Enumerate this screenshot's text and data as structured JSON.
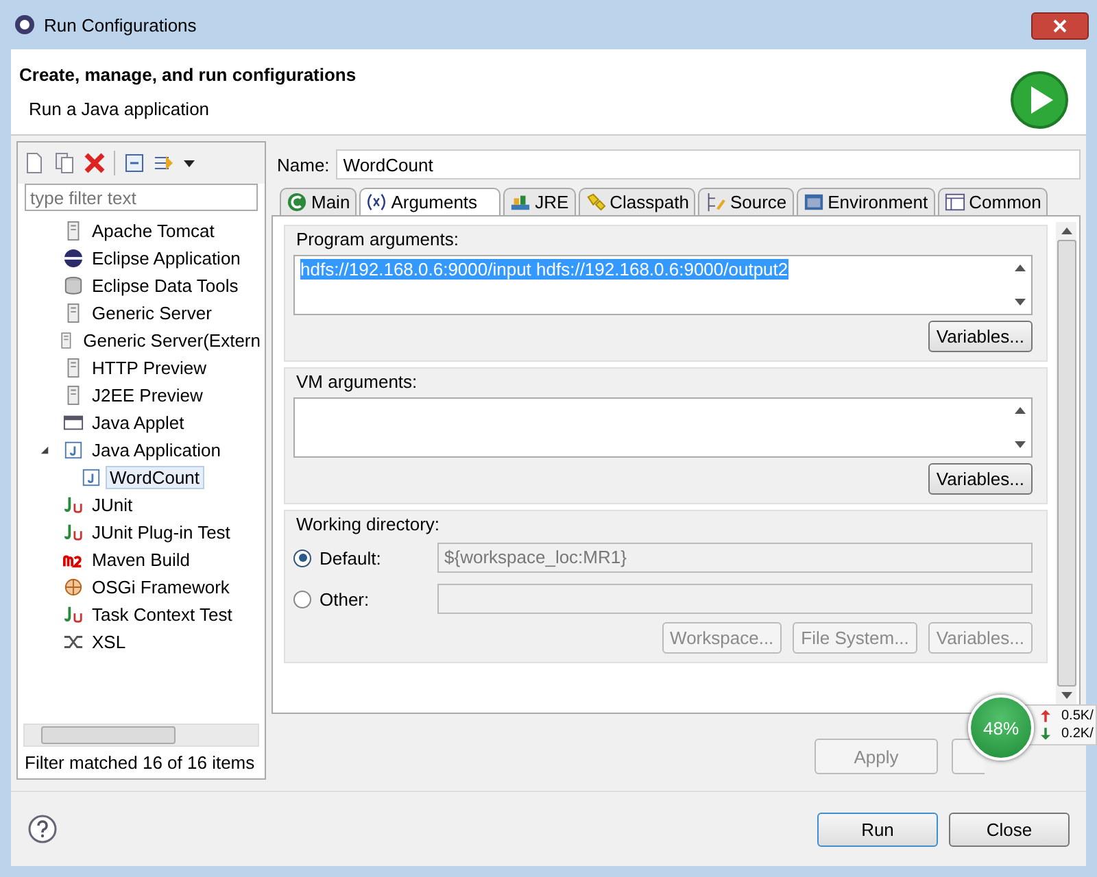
{
  "window": {
    "title": "Run Configurations"
  },
  "header": {
    "title": "Create, manage, and run configurations",
    "subtitle": "Run a Java application"
  },
  "sidebar": {
    "filter_placeholder": "type filter text",
    "items": [
      {
        "label": "Apache Tomcat",
        "selected": false
      },
      {
        "label": "Eclipse Application",
        "selected": false
      },
      {
        "label": "Eclipse Data Tools",
        "selected": false
      },
      {
        "label": "Generic Server",
        "selected": false
      },
      {
        "label": "Generic Server(Extern",
        "selected": false
      },
      {
        "label": "HTTP Preview",
        "selected": false
      },
      {
        "label": "J2EE Preview",
        "selected": false
      },
      {
        "label": "Java Applet",
        "selected": false
      },
      {
        "label": "Java Application",
        "selected": false,
        "expanded": true,
        "children": [
          {
            "label": "WordCount",
            "selected": true
          }
        ]
      },
      {
        "label": "JUnit",
        "selected": false
      },
      {
        "label": "JUnit Plug-in Test",
        "selected": false
      },
      {
        "label": "Maven Build",
        "selected": false
      },
      {
        "label": "OSGi Framework",
        "selected": false
      },
      {
        "label": "Task Context Test",
        "selected": false
      },
      {
        "label": "XSL",
        "selected": false
      }
    ],
    "status": "Filter matched 16 of 16 items"
  },
  "name": {
    "label": "Name:",
    "value": "WordCount"
  },
  "tabs": [
    {
      "label": "Main",
      "selected": false
    },
    {
      "label": "Arguments",
      "selected": true
    },
    {
      "label": "JRE",
      "selected": false
    },
    {
      "label": "Classpath",
      "selected": false
    },
    {
      "label": "Source",
      "selected": false
    },
    {
      "label": "Environment",
      "selected": false
    },
    {
      "label": "Common",
      "selected": false
    }
  ],
  "program_arguments": {
    "label": "Program arguments:",
    "value": "hdfs://192.168.0.6:9000/input hdfs://192.168.0.6:9000/output2",
    "button": "Variables..."
  },
  "vm_arguments": {
    "label": "VM arguments:",
    "button": "Variables..."
  },
  "working_directory": {
    "label": "Working directory:",
    "options": [
      {
        "label": "Default:",
        "selected": true,
        "value": "${workspace_loc:MR1}"
      },
      {
        "label": "Other:",
        "selected": false
      }
    ],
    "buttons": [
      "Workspace...",
      "File System...",
      "Variables..."
    ]
  },
  "footer": {
    "apply": "Apply",
    "run": "Run",
    "close": "Close"
  },
  "overlay": {
    "percent": "48%",
    "upload": "0.5K/",
    "download": "0.2K/"
  }
}
